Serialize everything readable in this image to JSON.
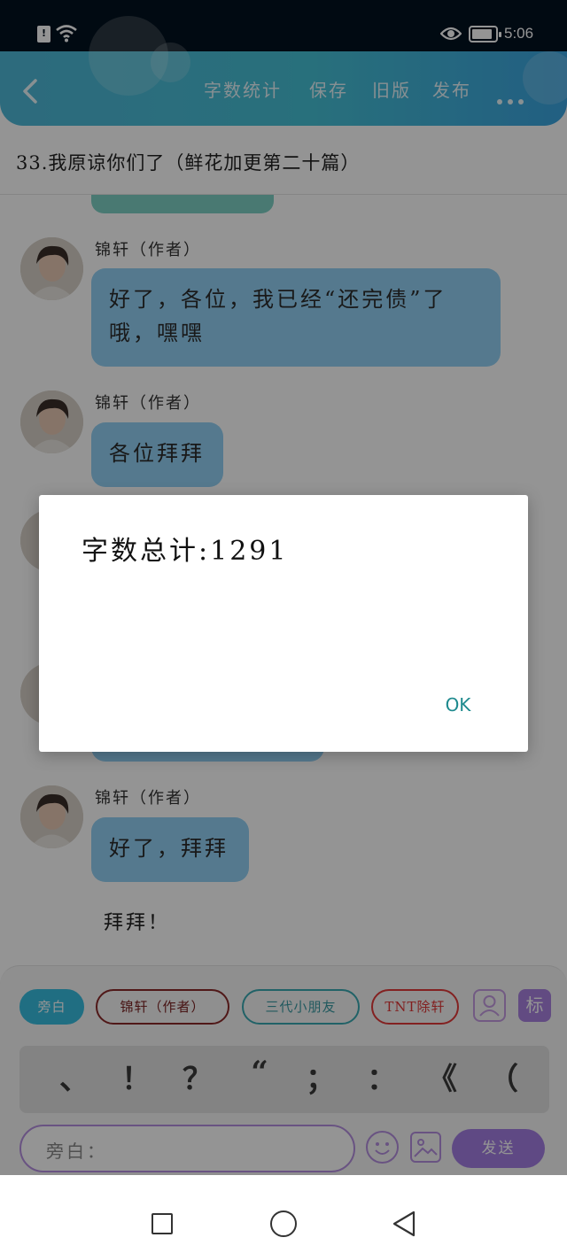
{
  "status_bar": {
    "time": "5:06"
  },
  "header": {
    "menu": [
      "字数统计",
      "保存",
      "旧版",
      "发布"
    ],
    "colors": {
      "gradient_start": "#4fb8d8",
      "gradient_end": "#3ba4e0"
    }
  },
  "chapter_title": "33.我原谅你们了（鲜花加更第二十篇）",
  "messages": [
    {
      "author": "锦轩（作者）",
      "text": "好了，各位，我已经“还完债”了哦，嘿嘿"
    },
    {
      "author": "锦轩（作者）",
      "text": "各位拜拜"
    },
    {
      "author": "锦轩（作者）",
      "text": "好了，拜拜"
    }
  ],
  "narration": "拜拜！",
  "role_chips": [
    "旁白",
    "锦轩（作者）",
    "三代小朋友",
    "TNT除轩"
  ],
  "tag_icon_label": "标",
  "punctuation": [
    "、",
    "！",
    "？",
    "“",
    "；",
    "：",
    "《",
    "（"
  ],
  "input": {
    "placeholder": "旁白："
  },
  "send_label": "发送",
  "dialog": {
    "message": "字数总计:1291",
    "ok_label": "OK"
  },
  "colors": {
    "bubble": "#93d1f4",
    "accent_purple": "#a47fe3",
    "active_chip": "#38bee0"
  }
}
